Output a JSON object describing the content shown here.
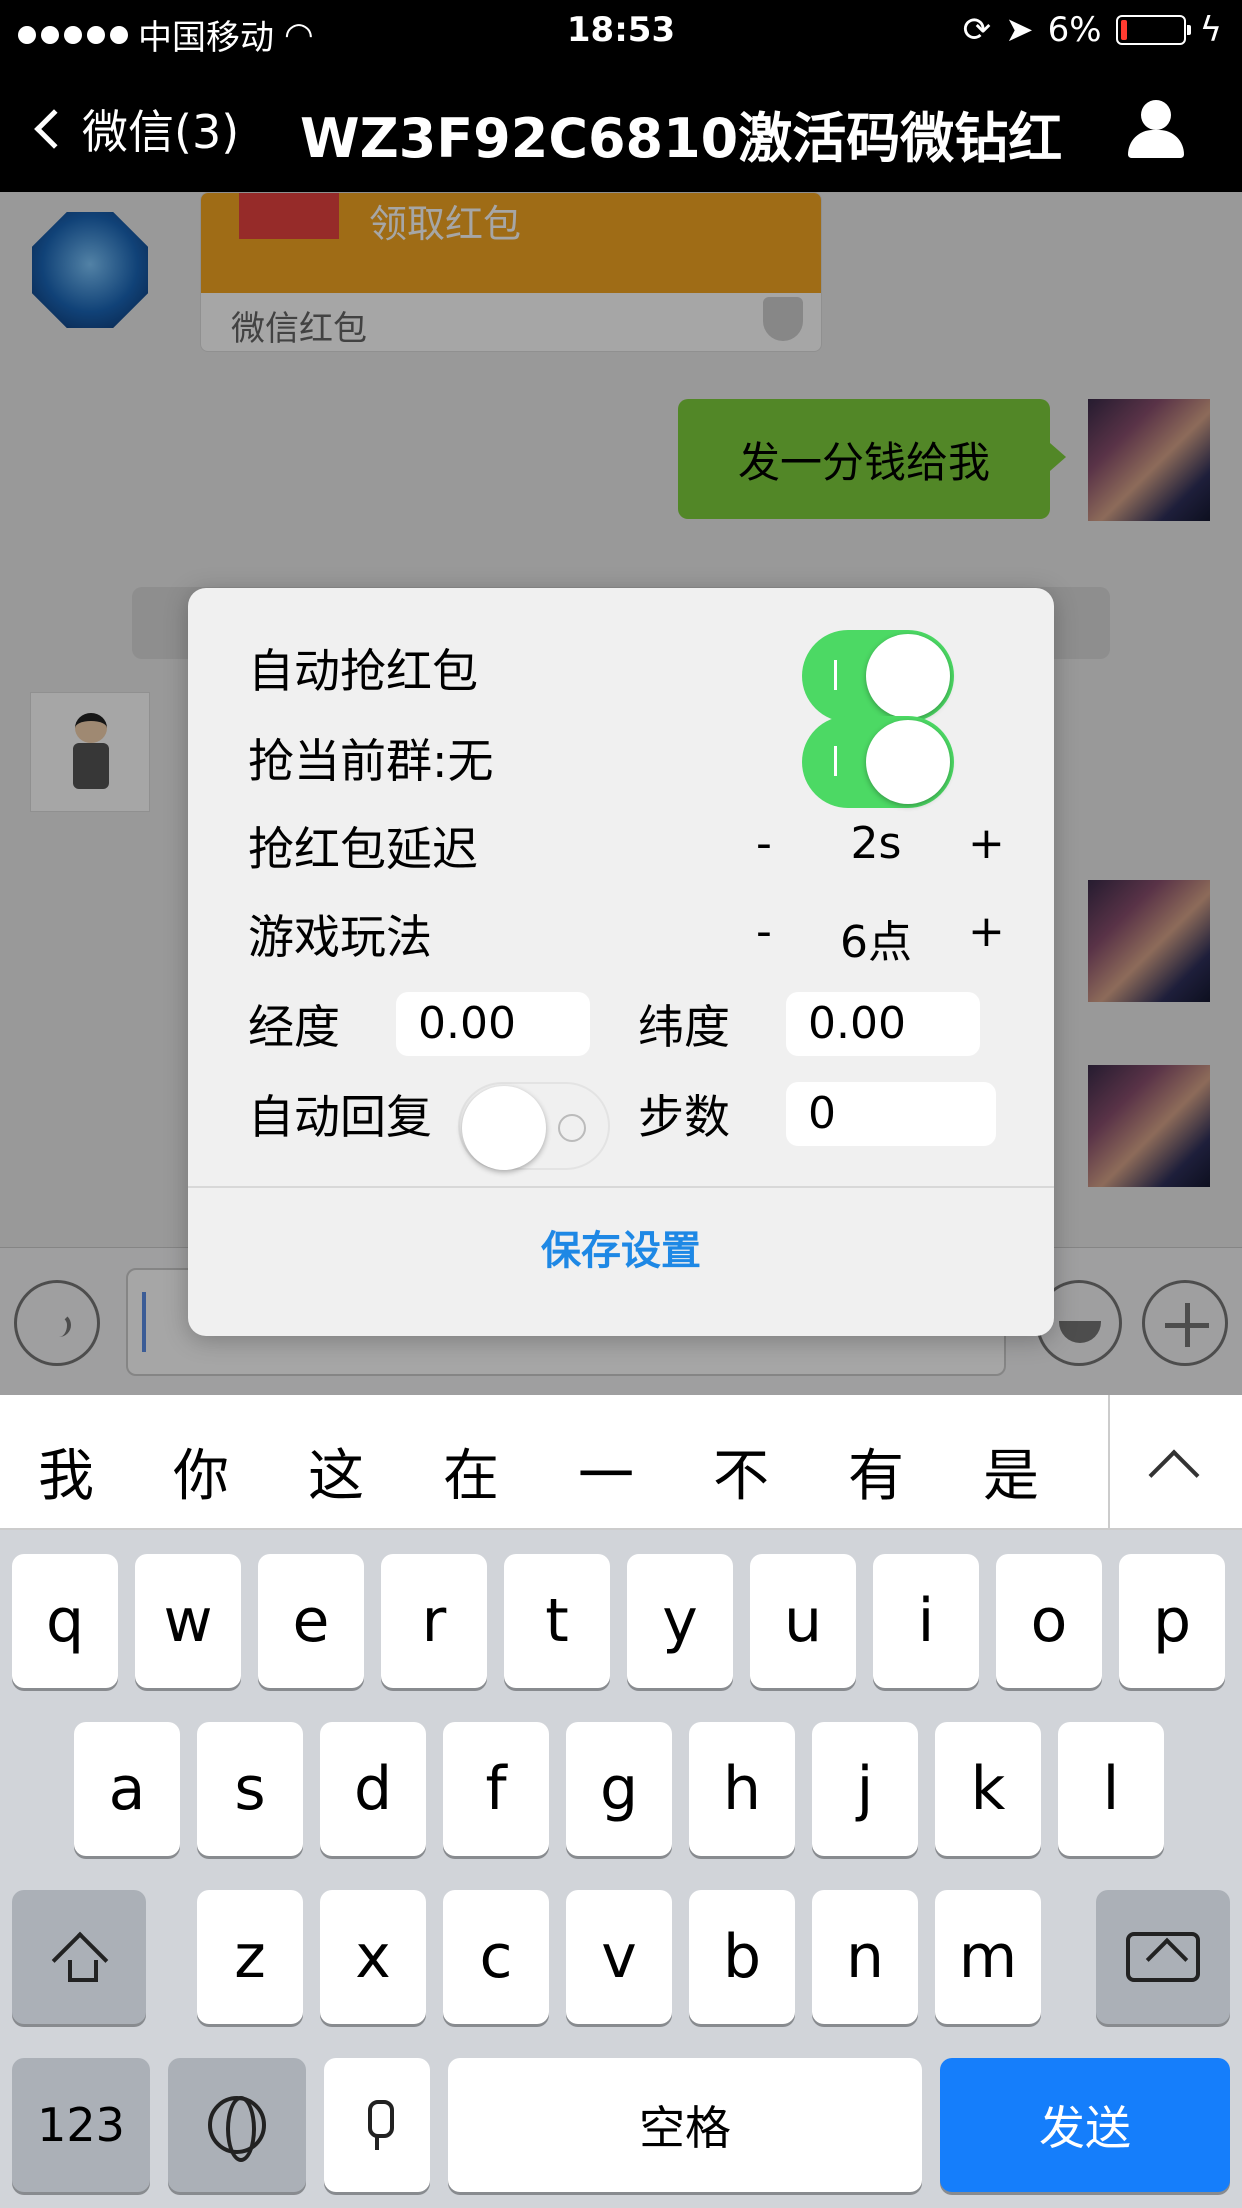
{
  "status_bar": {
    "carrier": "中国移动",
    "time": "18:53",
    "battery": "6%"
  },
  "nav": {
    "back_label": "微信(3)",
    "title": "WZ3F92C6810激活码微钻红"
  },
  "chat": {
    "red_packet_action": "领取红包",
    "red_packet_footer": "微信红包",
    "outgoing_text": "发一分钱给我"
  },
  "dialog": {
    "auto_grab_label": "自动抢红包",
    "auto_grab_on": true,
    "grab_group_label": "抢当前群:无",
    "grab_group_on": true,
    "delay_label": "抢红包延迟",
    "delay_value": "2s",
    "game_label": "游戏玩法",
    "game_value": "6点",
    "minus": "-",
    "plus": "+",
    "longitude_label": "经度",
    "longitude_value": "0.00",
    "latitude_label": "纬度",
    "latitude_value": "0.00",
    "auto_reply_label": "自动回复",
    "auto_reply_on": false,
    "steps_label": "步数",
    "steps_value": "0",
    "save_label": "保存设置"
  },
  "suggestions": [
    "我",
    "你",
    "这",
    "在",
    "一",
    "不",
    "有",
    "是"
  ],
  "keyboard": {
    "row1": [
      "q",
      "w",
      "e",
      "r",
      "t",
      "y",
      "u",
      "i",
      "o",
      "p"
    ],
    "row2": [
      "a",
      "s",
      "d",
      "f",
      "g",
      "h",
      "j",
      "k",
      "l"
    ],
    "row3": [
      "z",
      "x",
      "c",
      "v",
      "b",
      "n",
      "m"
    ],
    "numbers_label": "123",
    "space_label": "空格",
    "send_label": "发送"
  },
  "colors": {
    "switch_on": "#4cd964",
    "link_blue": "#1e88e5",
    "send_blue": "#157efb",
    "bubble_green": "#7fd03c",
    "red_packet_orange": "#f5a623"
  }
}
